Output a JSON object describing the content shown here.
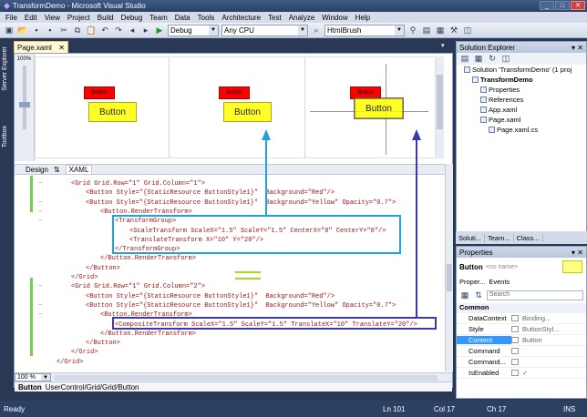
{
  "window": {
    "title": "TransformDemo - Microsoft Visual Studio"
  },
  "menu": [
    "File",
    "Edit",
    "View",
    "Project",
    "Build",
    "Debug",
    "Team",
    "Data",
    "Tools",
    "Architecture",
    "Test",
    "Analyze",
    "Window",
    "Help"
  ],
  "toolbar": {
    "config": "Debug",
    "platform": "Any CPU",
    "find": "HtmlBrush"
  },
  "sidebar": {
    "items": [
      "Server Explorer",
      "Toolbox"
    ]
  },
  "document": {
    "tab": "Page.xaml",
    "zoom_top": "100%",
    "zoom_bottom": "100 %"
  },
  "designer": {
    "red_label": "Button",
    "yellow_label": "Button"
  },
  "view_tabs": {
    "design": "Design",
    "xaml": "XAML"
  },
  "code_lines": [
    {
      "indent": 0,
      "text": "<Grid Grid.Row=\"1\" Grid.Column=\"1\">"
    },
    {
      "indent": 1,
      "text": "<Button Style=\"{StaticResource ButtonStyle1}\"  Background=\"Red\"/>"
    },
    {
      "indent": 1,
      "text": "<Button Style=\"{StaticResource ButtonStyle1}\"  Background=\"Yellow\" Opacity=\"0.7\">"
    },
    {
      "indent": 2,
      "text": "<Button.RenderTransform>"
    },
    {
      "indent": 3,
      "text": "<TransformGroup>"
    },
    {
      "indent": 4,
      "text": "<ScaleTransform ScaleX=\"1.5\" ScaleY=\"1.5\" CenterX=\"0\" CenterY=\"0\"/>"
    },
    {
      "indent": 4,
      "text": "<TranslateTransform X=\"10\" Y=\"20\"/>"
    },
    {
      "indent": 3,
      "text": "</TransformGroup>"
    },
    {
      "indent": 2,
      "text": "</Button.RenderTransform>"
    },
    {
      "indent": 1,
      "text": "</Button>"
    },
    {
      "indent": 0,
      "text": "</Grid>"
    },
    {
      "indent": 0,
      "text": "<Grid Grid.Row=\"1\" Grid.Column=\"2\">"
    },
    {
      "indent": 1,
      "text": "<Button Style=\"{StaticResource ButtonStyle1}\"  Background=\"Red\"/>"
    },
    {
      "indent": 1,
      "text": "<Button Style=\"{StaticResource ButtonStyle1}\"  Background=\"Yellow\" Opacity=\"0.7\">"
    },
    {
      "indent": 2,
      "text": "<Button.RenderTransform>"
    },
    {
      "indent": 3,
      "text": "<CompositeTransform ScaleX=\"1.5\" ScaleY=\"1.5\" TranslateX=\"10\" TranslateY=\"20\"/>"
    },
    {
      "indent": 2,
      "text": "</Button.RenderTransform>"
    },
    {
      "indent": 1,
      "text": "</Button>"
    },
    {
      "indent": 0,
      "text": "</Grid>"
    },
    {
      "indent": -1,
      "text": "</Grid>"
    }
  ],
  "breadcrumb": {
    "element": "Button",
    "path": "UserControl/Grid/Grid/Button"
  },
  "solution_explorer": {
    "title": "Solution Explorer",
    "items": [
      {
        "level": 0,
        "label": "Solution 'TransformDemo' (1 proj"
      },
      {
        "level": 1,
        "label": "TransformDemo"
      },
      {
        "level": 2,
        "label": "Properties"
      },
      {
        "level": 2,
        "label": "References"
      },
      {
        "level": 2,
        "label": "App.xaml"
      },
      {
        "level": 2,
        "label": "Page.xaml"
      },
      {
        "level": 3,
        "label": "Page.xaml.cs"
      }
    ]
  },
  "bottom_tabs": [
    "Soluti...",
    "Team...",
    "Class..."
  ],
  "properties": {
    "title": "Properties",
    "element": "Button",
    "name_placeholder": "<no name>",
    "tabs": [
      "Proper...",
      "Events"
    ],
    "search_placeholder": "Search",
    "category": "Common",
    "rows": [
      {
        "name": "DataContext",
        "value": "Binding..."
      },
      {
        "name": "Style",
        "value": "ButtonStyl..."
      },
      {
        "name": "Content",
        "value": "Button"
      },
      {
        "name": "Command",
        "value": ""
      },
      {
        "name": "Command...",
        "value": ""
      },
      {
        "name": "IsEnabled",
        "value": "✓"
      }
    ],
    "selected": "Content"
  },
  "status": {
    "ready": "Ready",
    "ln": "Ln 101",
    "col": "Col 17",
    "ch": "Ch 17",
    "mode": "INS"
  },
  "colors": {
    "highlight_box_1": "#1ea3e0",
    "highlight_box_2": "#3a3ab0",
    "red": "#ff0000",
    "yellow": "#ffff00"
  }
}
